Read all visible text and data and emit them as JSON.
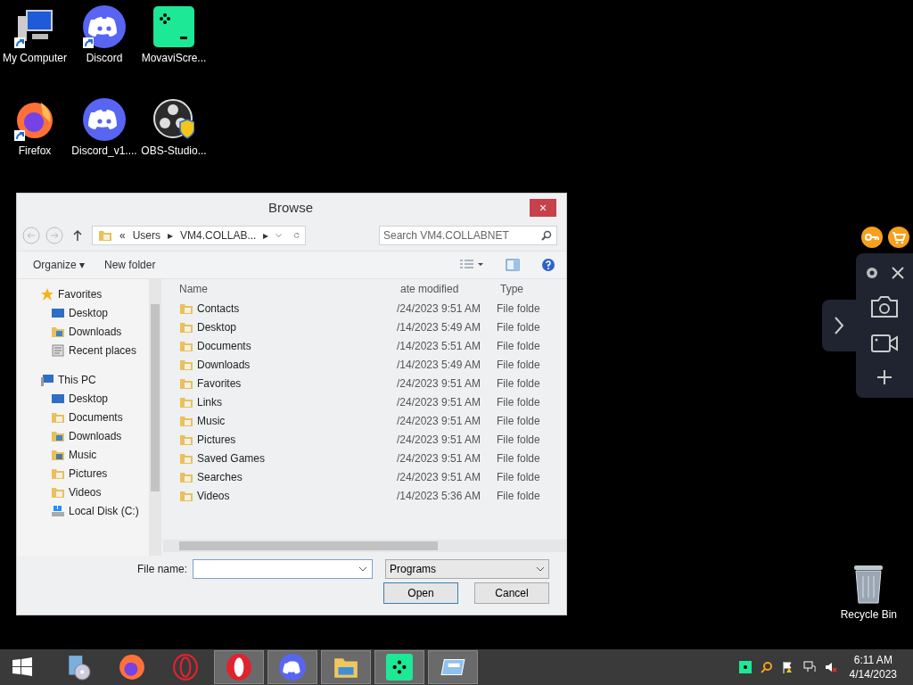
{
  "desktop_icons": [
    {
      "label": "My Computer",
      "kind": "computer",
      "shortcut": true
    },
    {
      "label": "Discord",
      "kind": "discord",
      "shortcut": true
    },
    {
      "label": "MovaviScre...",
      "kind": "movavi",
      "shortcut": false
    },
    {
      "label": "Firefox",
      "kind": "firefox",
      "shortcut": true
    },
    {
      "label": "Discord_v1....",
      "kind": "discord",
      "shortcut": false
    },
    {
      "label": "OBS-Studio...",
      "kind": "obs",
      "shortcut": false
    }
  ],
  "recycle_bin": {
    "label": "Recycle Bin"
  },
  "dialog": {
    "title": "Browse",
    "close": "×",
    "breadcrumb": [
      "«",
      "Users",
      "▸",
      "VM4.COLLAB...",
      "▸"
    ],
    "search": {
      "placeholder": "Search VM4.COLLABNET"
    },
    "toolbar": {
      "organize": "Organize ▾",
      "new_folder": "New folder"
    },
    "nav": [
      {
        "label": "Favorites",
        "kind": "star",
        "children": [
          {
            "label": "Desktop",
            "kind": "desktop"
          },
          {
            "label": "Downloads",
            "kind": "download"
          },
          {
            "label": "Recent places",
            "kind": "recent"
          }
        ]
      },
      {
        "label": "This PC",
        "kind": "pc",
        "children": [
          {
            "label": "Desktop",
            "kind": "desktop"
          },
          {
            "label": "Documents",
            "kind": "docs"
          },
          {
            "label": "Downloads",
            "kind": "download"
          },
          {
            "label": "Music",
            "kind": "music"
          },
          {
            "label": "Pictures",
            "kind": "pictures"
          },
          {
            "label": "Videos",
            "kind": "videos"
          },
          {
            "label": "Local Disk (C:)",
            "kind": "disk"
          }
        ]
      }
    ],
    "columns": [
      "Name",
      "ate modified",
      "Type"
    ],
    "rows": [
      {
        "name": "Contacts",
        "date": "/24/2023 9:51 AM",
        "type": "File folde"
      },
      {
        "name": "Desktop",
        "date": "/14/2023 5:49 AM",
        "type": "File folde"
      },
      {
        "name": "Documents",
        "date": "/14/2023 5:51 AM",
        "type": "File folde"
      },
      {
        "name": "Downloads",
        "date": "/14/2023 5:49 AM",
        "type": "File folde"
      },
      {
        "name": "Favorites",
        "date": "/24/2023 9:51 AM",
        "type": "File folde"
      },
      {
        "name": "Links",
        "date": "/24/2023 9:51 AM",
        "type": "File folde"
      },
      {
        "name": "Music",
        "date": "/24/2023 9:51 AM",
        "type": "File folde"
      },
      {
        "name": "Pictures",
        "date": "/24/2023 9:51 AM",
        "type": "File folde"
      },
      {
        "name": "Saved Games",
        "date": "/24/2023 9:51 AM",
        "type": "File folde"
      },
      {
        "name": "Searches",
        "date": "/24/2023 9:51 AM",
        "type": "File folde"
      },
      {
        "name": "Videos",
        "date": "/14/2023 5:36 AM",
        "type": "File folde"
      }
    ],
    "file_name": {
      "label": "File name:"
    },
    "file_type": "Programs",
    "buttons": [
      "Open",
      "Cancel"
    ]
  },
  "taskbar": {
    "items": [
      {
        "kind": "installer",
        "running": false
      },
      {
        "kind": "firefox",
        "running": false
      },
      {
        "kind": "opera-outline",
        "running": false
      },
      {
        "kind": "opera",
        "running": true
      },
      {
        "kind": "discord",
        "running": true
      },
      {
        "kind": "explorer",
        "running": true
      },
      {
        "kind": "movavi",
        "running": true
      },
      {
        "kind": "window",
        "running": true
      }
    ],
    "time": "6:11 AM",
    "date": "4/14/2023"
  }
}
